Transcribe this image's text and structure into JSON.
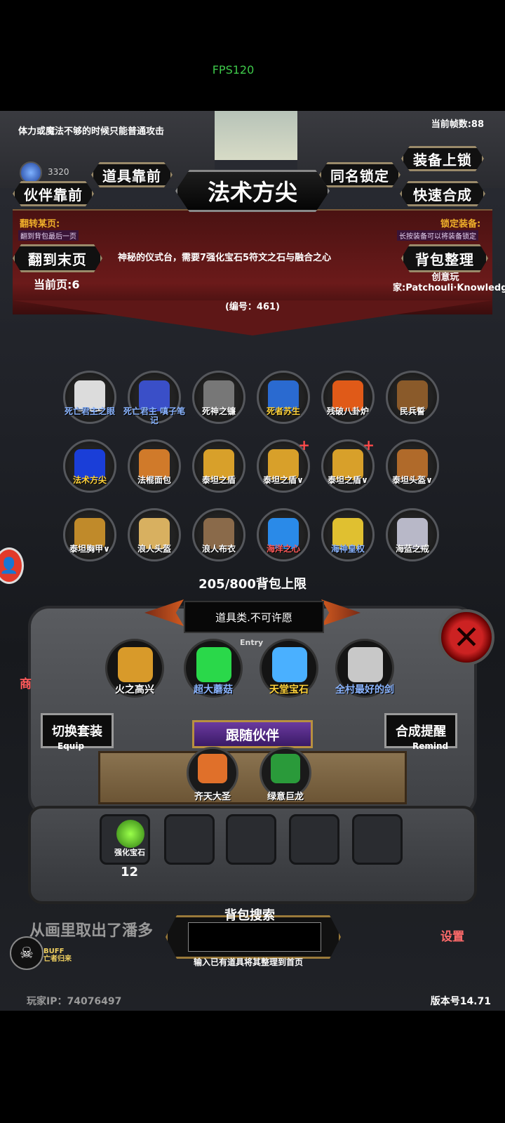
{
  "status_bar": {
    "fps": "FPS120"
  },
  "hud": {
    "hint": "体力或魔法不够的时候只能普通攻击",
    "frame_count": "当前帧数:88",
    "currency": "3320"
  },
  "buttons": {
    "companion_front": "伙伴靠前",
    "item_front": "道具靠前",
    "same_name_lock": "同名锁定",
    "equip_lock": "装备上锁",
    "quick_merge": "快速合成",
    "last_page": "翻到末页",
    "sort_bag": "背包整理"
  },
  "title": "法术方尖",
  "banner": {
    "flip_label": "翻转某页:",
    "flip_sub": "翻到背包最后一页",
    "lock_label": "锁定装备:",
    "lock_sub": "长按装备可以将装备锁定",
    "description": "神秘的仪式台，需要7强化宝石5符文之石与融合之心",
    "current_page": "当前页:6",
    "creator": "创意玩家:Patchouli·Knowledge",
    "id_number": "(编号：461)"
  },
  "inventory": [
    {
      "name": "死亡君主之眼",
      "color": "#8ab4ff",
      "icon": "#dcdcdc",
      "plus": false
    },
    {
      "name": "死亡君主\n嗔子笔记",
      "color": "#8ab4ff",
      "icon": "#3a4fc8",
      "plus": false
    },
    {
      "name": "死神之镰",
      "color": "#ffffff",
      "icon": "#777777",
      "plus": false
    },
    {
      "name": "死者苏生",
      "color": "#ffd23a",
      "icon": "#2a6ad0",
      "plus": false
    },
    {
      "name": "残破八卦炉",
      "color": "#ffffff",
      "icon": "#e05a18",
      "plus": false
    },
    {
      "name": "民兵誓",
      "color": "#ffffff",
      "icon": "#8a5a2a",
      "plus": false
    },
    {
      "name": "法术方尖",
      "color": "#ffd23a",
      "icon": "#1a3ed8",
      "plus": false
    },
    {
      "name": "法棍面包",
      "color": "#ffffff",
      "icon": "#d07a2a",
      "plus": false
    },
    {
      "name": "泰坦之盾",
      "color": "#ffffff",
      "icon": "#d8a02a",
      "plus": false
    },
    {
      "name": "泰坦之盾∨",
      "color": "#ffffff",
      "icon": "#d8a02a",
      "plus": true
    },
    {
      "name": "泰坦之盾∨",
      "color": "#ffffff",
      "icon": "#d8a02a",
      "plus": true
    },
    {
      "name": "泰坦头盔∨",
      "color": "#ffffff",
      "icon": "#b06a2a",
      "plus": false
    },
    {
      "name": "泰坦胸甲∨",
      "color": "#ffffff",
      "icon": "#c08a2a",
      "plus": false
    },
    {
      "name": "浪人头盔",
      "color": "#ffffff",
      "icon": "#d8b060",
      "plus": false
    },
    {
      "name": "浪人布衣",
      "color": "#ffffff",
      "icon": "#8a6a4a",
      "plus": false
    },
    {
      "name": "海洋之心",
      "color": "#ff5a5a",
      "icon": "#2a8ae8",
      "plus": false
    },
    {
      "name": "海神皇权",
      "color": "#8ab4ff",
      "icon": "#e0c030",
      "plus": false
    },
    {
      "name": "海蓝之戒",
      "color": "#ffffff",
      "icon": "#b8b8c8",
      "plus": false
    }
  ],
  "capacity": "205/800背包上限",
  "entry": {
    "text": "道具类.不可许愿",
    "label": "Entry"
  },
  "featured": [
    {
      "name": "火之高兴",
      "color": "#ffffff",
      "icon": "#d89a2a"
    },
    {
      "name": "超大蘑菇",
      "color": "#8ab4ff",
      "icon": "#2ad84a"
    },
    {
      "name": "天堂宝石",
      "color": "#ffd23a",
      "icon": "#4ab0ff"
    },
    {
      "name": "全村最好的剑",
      "color": "#8ab4ff",
      "icon": "#c8c8c8"
    }
  ],
  "side": {
    "switch_outfit": "切换套装",
    "switch_sub": "Equip",
    "merge_remind": "合成提醒",
    "merge_sub": "Remind"
  },
  "companions": {
    "title": "跟随伙伴",
    "list": [
      {
        "name": "齐天大圣",
        "icon": "#e0702a"
      },
      {
        "name": "绿意巨龙",
        "icon": "#2a9a3a"
      }
    ]
  },
  "slots": {
    "item_name": "强化宝石",
    "item_count": "12"
  },
  "search": {
    "label": "背包搜索",
    "value": "",
    "hint": "输入已有道具将其整理到首页"
  },
  "footer": {
    "message": "从画里取出了潘多",
    "buff": "BUFF",
    "buff_sub": "亡者归来",
    "player_ip": "玩家IP：74076497",
    "version": "版本号14.71",
    "settings": "设置",
    "shop": "商"
  }
}
